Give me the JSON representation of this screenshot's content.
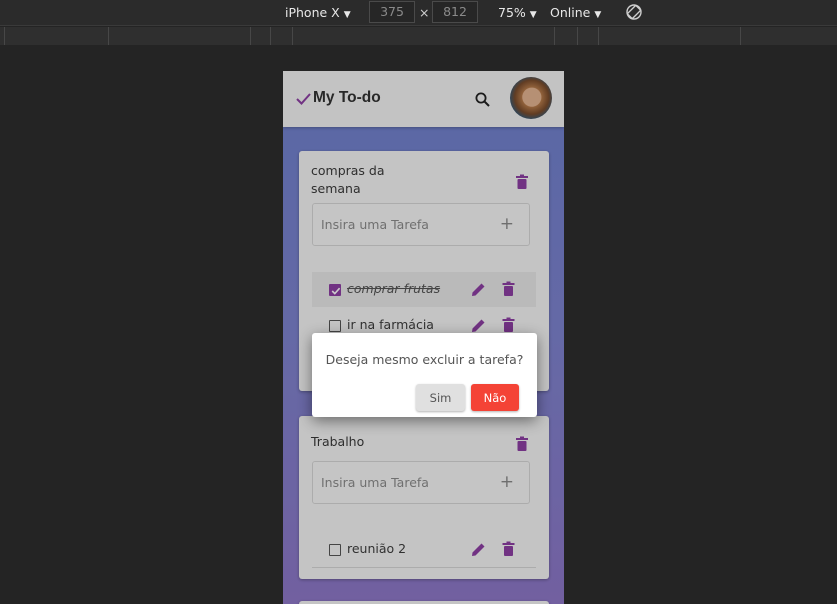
{
  "devtools": {
    "device": "iPhone X",
    "width": "375",
    "height": "812",
    "separator": "×",
    "zoom": "75%",
    "network": "Online"
  },
  "app": {
    "title": "My To-do",
    "accent": "#8e3fa4",
    "lists": [
      {
        "title": "compras da semana",
        "placeholder": "Insira uma Tarefa",
        "add": "+",
        "tasks": [
          {
            "label": "comprar frutas",
            "done": true
          },
          {
            "label": "ir na farmácia",
            "done": false
          }
        ]
      },
      {
        "title": "Trabalho",
        "placeholder": "Insira uma Tarefa",
        "add": "+",
        "tasks": [
          {
            "label": "reunião 2",
            "done": false
          }
        ]
      }
    ]
  },
  "dialog": {
    "message": "Deseja mesmo excluir a tarefa?",
    "confirm": "Sim",
    "cancel": "Não",
    "cancel_color": "#f44336"
  }
}
